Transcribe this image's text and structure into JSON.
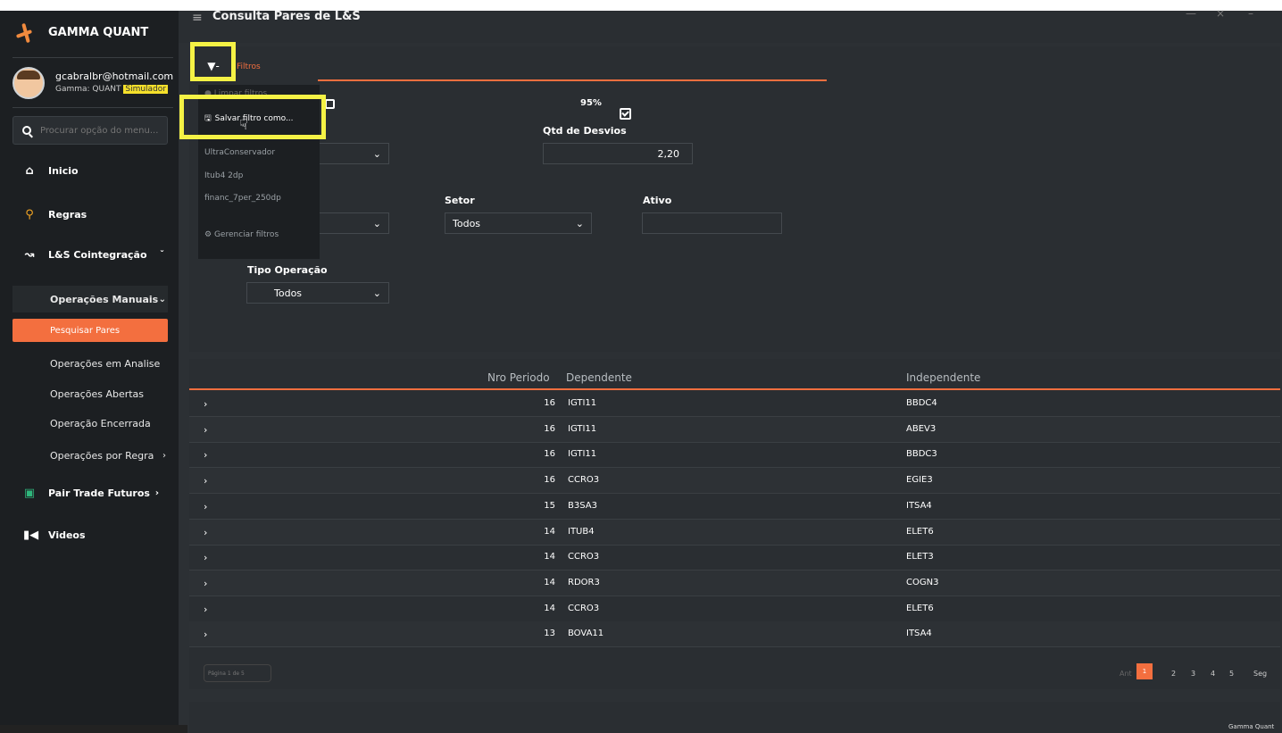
{
  "app": {
    "brand": "GAMMA QUANT",
    "page_title": "Consulta Pares de L&S",
    "footer_brand": "Gamma Quant",
    "colors": {
      "accent": "#f36f3f",
      "highlight": "#f5f245",
      "bg": "#2c3034",
      "sidebar": "#1c1f22"
    }
  },
  "user": {
    "email": "gcabralbr@hotmail.com",
    "role": "Gamma: QUANT",
    "mode_badge": "Simulador"
  },
  "sidebar": {
    "search_placeholder": "Procurar opção do menu...",
    "items": [
      {
        "label": "Inicio",
        "icon": "home-icon"
      },
      {
        "label": "Regras",
        "icon": "search-icon"
      },
      {
        "label": "L&S Cointegração",
        "icon": "chart-line-icon"
      },
      {
        "label": "Pair Trade Futuros",
        "icon": "money-icon"
      },
      {
        "label": "Videos",
        "icon": "video-icon"
      }
    ],
    "sub_items": [
      {
        "label": "Operações Manuais"
      },
      {
        "label": "Pesquisar Pares"
      },
      {
        "label": "Operações em Analise"
      },
      {
        "label": "Operações Abertas"
      },
      {
        "label": "Operação Encerrada"
      },
      {
        "label": "Operações por Regra"
      }
    ]
  },
  "filters": {
    "filter_button": "▼-",
    "tab_label": "Filtros",
    "dropdown": {
      "clear": "Limpar filtros",
      "save_as": "Salvar filtro como...",
      "saved": [
        "UltraConservador",
        "Itub4 2dp",
        "financ_7per_250dp"
      ],
      "manage": "Gerenciar filtros"
    },
    "conf_label": "95%",
    "qtd_desvios_label": "Qtd de Desvios",
    "qtd_desvios_value": "2,20",
    "setor_label": "Setor",
    "setor_value": "Todos",
    "ativo_label": "Ativo",
    "ativo_value": "",
    "tipo_label": "Tipo Operação",
    "tipo_value": "Todos"
  },
  "table": {
    "headers": {
      "periodo": "Nro Periodo",
      "dependente": "Dependente",
      "independente": "Independente"
    },
    "rows": [
      {
        "periodo": "16",
        "dependente": "IGTI11",
        "independente": "BBDC4"
      },
      {
        "periodo": "16",
        "dependente": "IGTI11",
        "independente": "ABEV3"
      },
      {
        "periodo": "16",
        "dependente": "IGTI11",
        "independente": "BBDC3"
      },
      {
        "periodo": "16",
        "dependente": "CCRO3",
        "independente": "EGIE3"
      },
      {
        "periodo": "15",
        "dependente": "B3SA3",
        "independente": "ITSA4"
      },
      {
        "periodo": "14",
        "dependente": "ITUB4",
        "independente": "ELET6"
      },
      {
        "periodo": "14",
        "dependente": "CCRO3",
        "independente": "ELET3"
      },
      {
        "periodo": "14",
        "dependente": "RDOR3",
        "independente": "COGN3"
      },
      {
        "periodo": "14",
        "dependente": "CCRO3",
        "independente": "ELET6"
      },
      {
        "periodo": "13",
        "dependente": "BOVA11",
        "independente": "ITSA4"
      }
    ]
  },
  "pagination": {
    "info": "Página 1 de 5",
    "prev": "Ant",
    "pages": [
      "1",
      "2",
      "3",
      "4",
      "5"
    ],
    "next": "Seg"
  }
}
